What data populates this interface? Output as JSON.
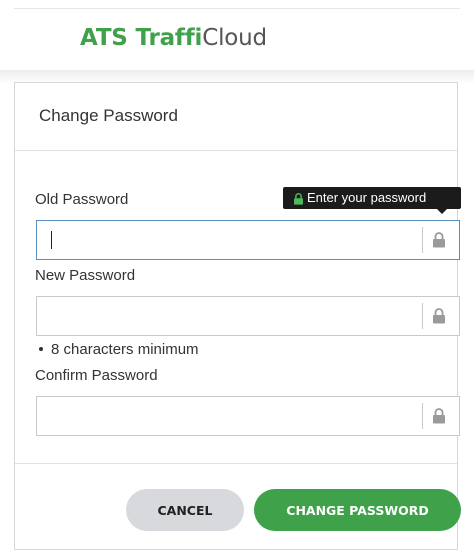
{
  "brand": {
    "part1": "ATS Traffi",
    "part2": "Cloud",
    "accent_color": "#3fa14a"
  },
  "dialog": {
    "title": "Change Password",
    "tooltip": {
      "text": "Enter your password",
      "icon": "lock-icon"
    },
    "fields": {
      "old_password": {
        "label": "Old Password",
        "value": "",
        "icon": "lock-icon"
      },
      "new_password": {
        "label": "New Password",
        "value": "",
        "icon": "lock-icon"
      },
      "confirm_password": {
        "label": "Confirm Password",
        "value": "",
        "icon": "lock-icon"
      }
    },
    "hint": "8 characters minimum",
    "buttons": {
      "cancel": "CANCEL",
      "change": "CHANGE PASSWORD"
    }
  }
}
